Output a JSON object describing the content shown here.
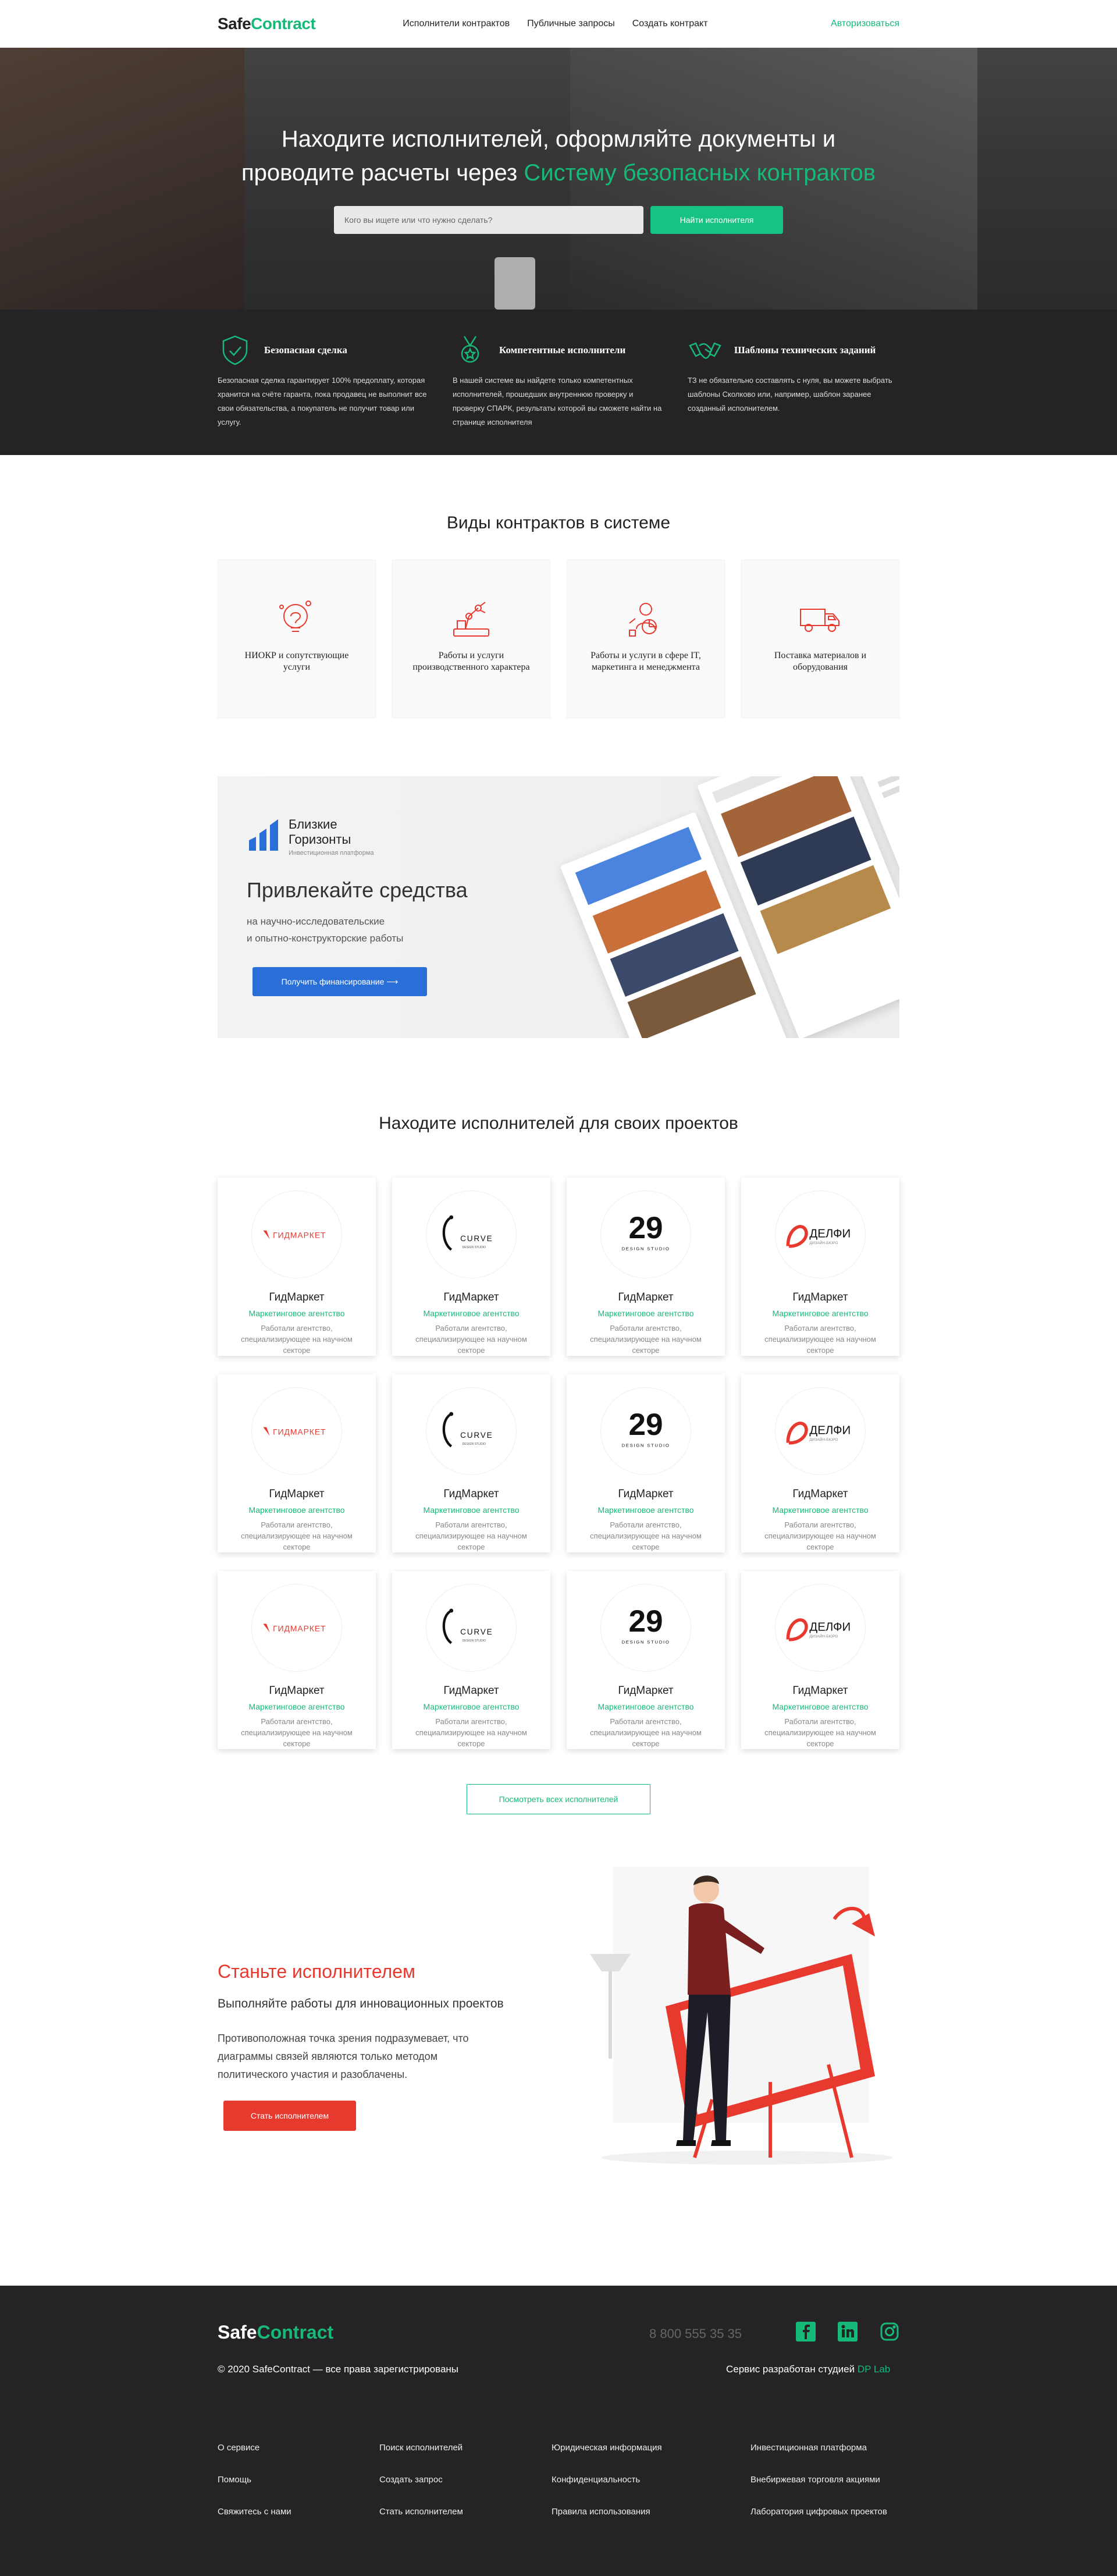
{
  "header": {
    "logo_a": "Safe",
    "logo_b": "Contract",
    "nav": [
      "Исполнители контрактов",
      "Публичные запросы",
      "Создать контракт"
    ],
    "auth": "Авторизоваться"
  },
  "hero": {
    "title_line1": "Находите исполнителей, оформляйте документы и",
    "title_line2_a": "проводите расчеты через ",
    "title_line2_b": "Систему безопасных контрактов",
    "search_placeholder": "Кого вы ищете или что нужно сделать?",
    "find_button": "Найти исполнителя"
  },
  "features": [
    {
      "title": "Безопасная сделка",
      "icon": "shield-icon",
      "text": "Безопасная сделка гарантирует 100% предоплату, которая хранится на счёте гаранта, пока продавец не выполнит все свои обязательства, а покупатель не получит товар или услугу."
    },
    {
      "title": "Компетентные исполнители",
      "icon": "medal-icon",
      "text": "В нашей системе вы найдете только компетентных исполнителей, прошедших внутреннюю проверку и проверку СПАРК, результаты которой вы сможете найти на странице исполнителя"
    },
    {
      "title": "Шаблоны технических заданий",
      "icon": "handshake-icon",
      "text": "ТЗ не обязательно составлять с нуля, вы можете выбрать шаблоны Сколково или, например, шаблон заранее созданный исполнителем."
    }
  ],
  "contracts": {
    "title": "Виды контрактов в системе",
    "items": [
      {
        "label": "НИОКР и сопутствующие услуги",
        "icon": "research-icon"
      },
      {
        "label": "Работы и услуги производственного характера",
        "icon": "robot-arm-icon"
      },
      {
        "label": "Работы и услуги в сфере IT, маркетинга и менеджмента",
        "icon": "analytics-icon"
      },
      {
        "label": "Поставка материалов и оборудования",
        "icon": "truck-icon"
      }
    ]
  },
  "banner": {
    "brand_line1": "Близкие",
    "brand_line2": "Горизонты",
    "brand_sub": "Инвестиционная платформа",
    "title": "Привлекайте средства",
    "desc_line1": "на научно-исследовательские",
    "desc_line2": "и опытно-конструкторские работы",
    "button": "Получить финансирование ⟶"
  },
  "partners": {
    "title": "Находите исполнителей для своих проектов",
    "logos": [
      "ГИДМАРКЕТ",
      "CURVE",
      "29",
      "ДЕЛФИ"
    ],
    "logo_sub": [
      "",
      "DESIGN STUDIO",
      "DESIGN STUDIO",
      "ДИЗАЙН-БЮРО"
    ],
    "card_name": "ГидМаркет",
    "card_type": "Маркетинговое агентство",
    "card_desc": "Работали агентство, специализирующее на научном секторе",
    "all_button": "Посмотреть всех исполнителей"
  },
  "become": {
    "title": "Станьте исполнителем",
    "subtitle": "Выполняйте работы для инновационных проектов",
    "text": "Противоположная точка зрения подразумевает, что диаграммы связей являются только методом политического участия и разоблачены.",
    "button": "Стать исполнителем"
  },
  "footer": {
    "logo_a": "Safe",
    "logo_b": "Contract",
    "phone": "8 800 555 35 35",
    "copyright": "© 2020 SafeContract — все права зарегистрированы",
    "dev_a": "Сервис разработан студией ",
    "dev_b": "DP Lab",
    "col1": [
      "О сервисе",
      "Помощь",
      "Свяжитесь с нами"
    ],
    "col2": [
      "Поиск исполнителей",
      "Создать запрос",
      "Стать исполнителем"
    ],
    "col3": [
      "Юридическая информация",
      "Конфиденциальность",
      "Правила использования"
    ],
    "col4": [
      "Инвестиционная платформа",
      "Внебиржевая торговля акциями",
      "Лаборатория цифровых проектов"
    ]
  },
  "colors": {
    "accent": "#17b978",
    "red": "#e8392f",
    "blue": "#2a6fd8",
    "dark": "#262326"
  }
}
